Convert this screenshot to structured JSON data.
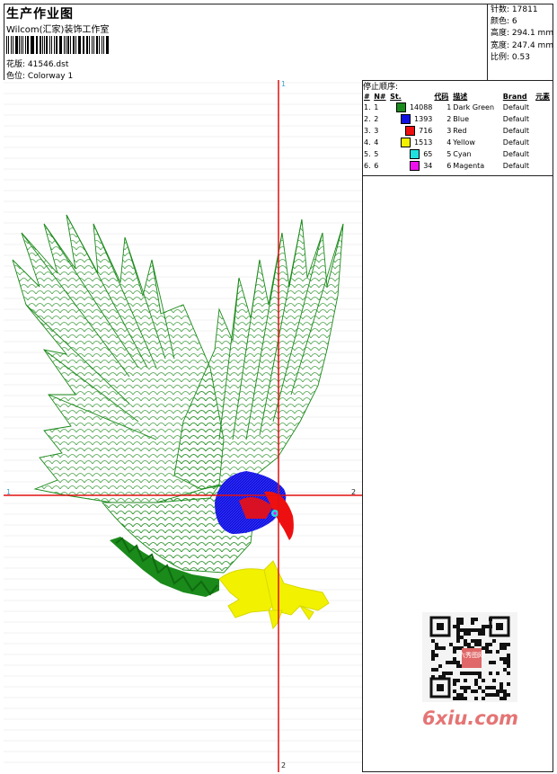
{
  "header": {
    "title": "生产作业图",
    "company": "Wilcom(汇家)装饰工作室",
    "design_label": "花版:",
    "design_value": "41546.dst",
    "colorway_label": "色位:",
    "colorway_value": "Colorway 1"
  },
  "stats": {
    "stitches_label": "针数:",
    "stitches_value": "17811",
    "colors_label": "颜色:",
    "colors_value": "6",
    "height_label": "高度:",
    "height_value": "294.1 mm",
    "width_label": "宽度:",
    "width_value": "247.4 mm",
    "scale_label": "比例:",
    "scale_value": "0.53"
  },
  "stop_sequence": {
    "heading": "停止顺序:",
    "columns": [
      "#",
      "N#",
      "St.",
      "代码",
      "描述",
      "Brand",
      "元素"
    ],
    "rows": [
      {
        "idx": "1.",
        "n": "1",
        "color": "#1a8a1a",
        "st": "14088",
        "code": "1",
        "desc": "Dark Green",
        "brand": "Default"
      },
      {
        "idx": "2.",
        "n": "2",
        "color": "#1010e0",
        "st": "1393",
        "code": "2",
        "desc": "Blue",
        "brand": "Default"
      },
      {
        "idx": "3.",
        "n": "3",
        "color": "#ee1010",
        "st": "716",
        "code": "3",
        "desc": "Red",
        "brand": "Default"
      },
      {
        "idx": "4.",
        "n": "4",
        "color": "#f2f200",
        "st": "1513",
        "code": "4",
        "desc": "Yellow",
        "brand": "Default"
      },
      {
        "idx": "5.",
        "n": "5",
        "color": "#20e0e0",
        "st": "65",
        "code": "5",
        "desc": "Cyan",
        "brand": "Default"
      },
      {
        "idx": "6.",
        "n": "6",
        "color": "#ee10ee",
        "st": "34",
        "code": "6",
        "desc": "Magenta",
        "brand": "Default"
      }
    ]
  },
  "axes": {
    "top": "1",
    "bottom": "2",
    "left": "1",
    "right": "2"
  },
  "watermark": {
    "site": "6xiu.com",
    "stamp": "六秀图网"
  },
  "colors": {
    "crosshair": "#e01010",
    "outline_green": "#1a8a1a",
    "head_blue": "#1010e0",
    "beak_red": "#ee1010",
    "talon_yellow": "#f2f200"
  }
}
